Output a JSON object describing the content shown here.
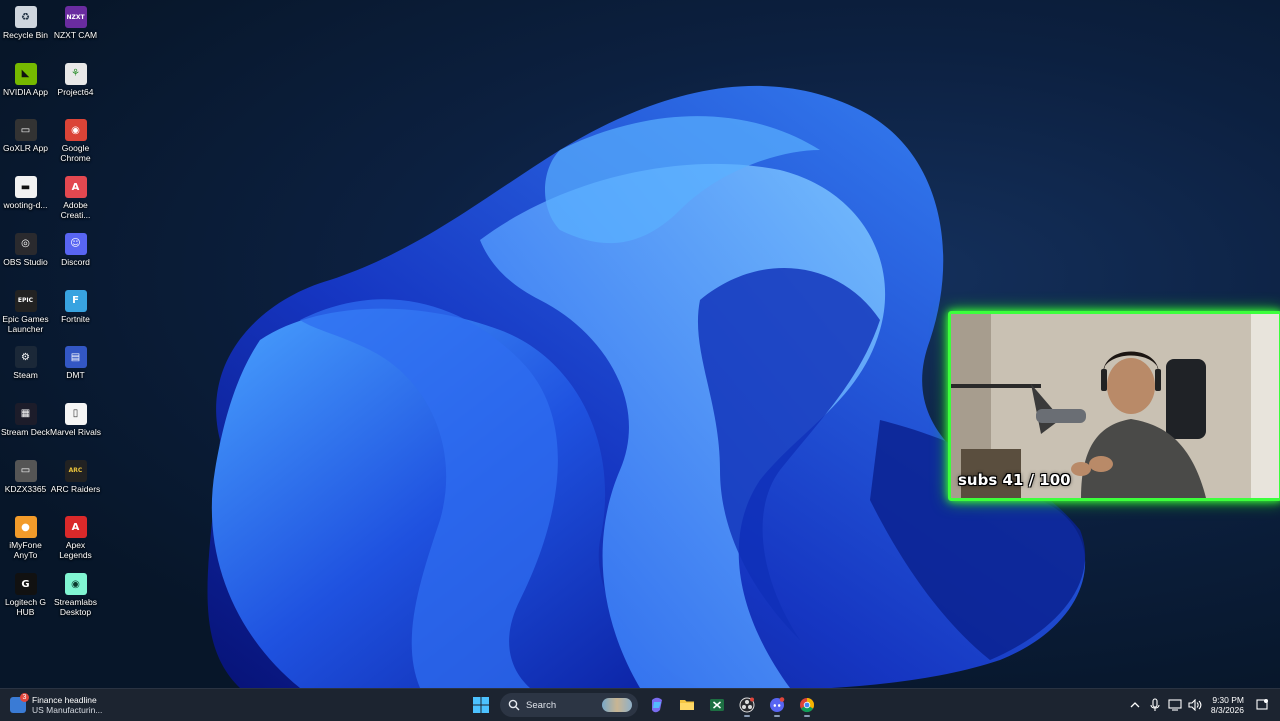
{
  "desktop": {
    "icons": [
      {
        "label": "Recycle Bin",
        "icon": "recycle-bin-icon"
      },
      {
        "label": "NZXT CAM",
        "icon": "nzxt-cam-icon"
      },
      {
        "label": "NVIDIA App",
        "icon": "nvidia-icon"
      },
      {
        "label": "Project64",
        "icon": "project64-icon"
      },
      {
        "label": "GoXLR App",
        "icon": "goxlr-icon"
      },
      {
        "label": "Google Chrome",
        "icon": "chrome-icon"
      },
      {
        "label": "wooting-d...",
        "icon": "wooting-icon"
      },
      {
        "label": "Adobe Creati...",
        "icon": "adobe-creative-cloud-icon"
      },
      {
        "label": "OBS Studio",
        "icon": "obs-icon"
      },
      {
        "label": "Discord",
        "icon": "discord-icon"
      },
      {
        "label": "Epic Games Launcher",
        "icon": "epic-games-icon"
      },
      {
        "label": "Fortnite",
        "icon": "fortnite-icon"
      },
      {
        "label": "Steam",
        "icon": "steam-icon"
      },
      {
        "label": "DMT",
        "icon": "dmt-icon"
      },
      {
        "label": "Stream Deck",
        "icon": "stream-deck-icon"
      },
      {
        "label": "Marvel Rivals",
        "icon": "marvel-rivals-icon"
      },
      {
        "label": "KDZX3365",
        "icon": "keyboard-icon"
      },
      {
        "label": "ARC Raiders",
        "icon": "arc-raiders-icon"
      },
      {
        "label": "iMyFone AnyTo",
        "icon": "imyfone-icon"
      },
      {
        "label": "Apex Legends",
        "icon": "apex-legends-icon"
      },
      {
        "label": "Logitech G HUB",
        "icon": "logitech-ghub-icon"
      },
      {
        "label": "Streamlabs Desktop",
        "icon": "streamlabs-icon"
      }
    ],
    "glyphs": [
      "♻",
      "NZXT",
      "◣",
      "⚘",
      "▭",
      "◉",
      "▬",
      "A",
      "◎",
      "☺",
      "EPIC",
      "F",
      "⚙",
      "▤",
      "▦",
      "▯",
      "▭",
      "ARC",
      "●",
      "A",
      "G",
      "◉"
    ]
  },
  "webcam": {
    "overlay_text": "subs 41 / 100",
    "border_color": "#3cff3c"
  },
  "taskbar": {
    "widget": {
      "headline": "Finance headline",
      "subline": "US Manufacturin...",
      "badge": "3"
    },
    "search_label": "Search",
    "apps": [
      "start-icon",
      "copilot-icon",
      "file-explorer-icon",
      "excel-icon",
      "obs-taskbar-icon",
      "discord-taskbar-icon",
      "chrome-taskbar-icon"
    ],
    "tray": {
      "time": "9:30 PM",
      "date": "8/3/2026"
    }
  },
  "colors": {
    "taskbar_bg": "#1c2430",
    "accent_green": "#3cff3c",
    "wallpaper_blue": "#1d4fd8"
  }
}
